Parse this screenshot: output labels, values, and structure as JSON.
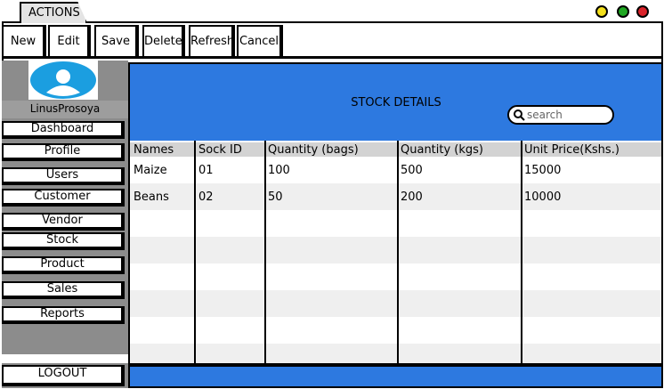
{
  "window": {
    "tab_label": "ACTIONS",
    "controls": [
      {
        "name": "yellow",
        "color": "#f4e01c"
      },
      {
        "name": "green",
        "color": "#1fa722"
      },
      {
        "name": "red",
        "color": "#d9232a"
      }
    ]
  },
  "toolbar": {
    "new_label": "New",
    "edit_label": "Edit",
    "save_label": "Save",
    "delete_label": "Delete",
    "refresh_label": "Refresh",
    "cancel_label": "Cancel"
  },
  "sidebar": {
    "username": "LinusProsoya",
    "items": [
      {
        "label": "Dashboard"
      },
      {
        "label": "Profile"
      },
      {
        "label": "Users"
      },
      {
        "label": "Customer"
      },
      {
        "label": "Vendor"
      },
      {
        "label": "Stock"
      },
      {
        "label": "Product"
      },
      {
        "label": "Sales"
      },
      {
        "label": "Reports"
      }
    ],
    "logout_label": "LOGOUT"
  },
  "main": {
    "title": "STOCK DETAILS",
    "search_placeholder": "search",
    "accent_color": "#2d79e0",
    "table": {
      "headers": [
        "Names",
        "Sock ID",
        "Quantity (bags)",
        "Quantity (kgs)",
        "Unit Price(Kshs.)"
      ],
      "rows": [
        [
          "Maize",
          "01",
          "100",
          "500",
          "15000"
        ],
        [
          "Beans",
          "02",
          "50",
          "200",
          "10000"
        ]
      ]
    }
  }
}
